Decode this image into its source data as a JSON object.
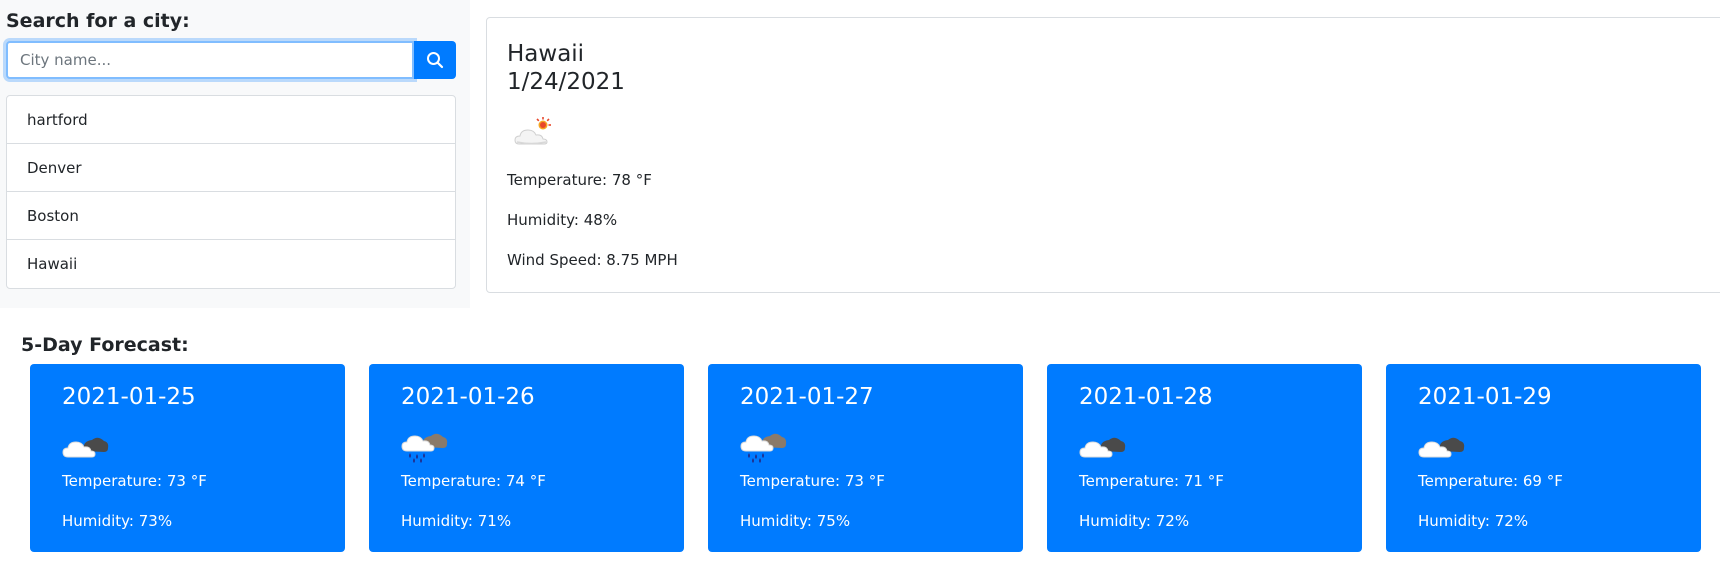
{
  "search": {
    "label": "Search for a city:",
    "placeholder": "City name..."
  },
  "history": [
    "hartford",
    "Denver",
    "Boston",
    "Hawaii"
  ],
  "current": {
    "city": "Hawaii",
    "date": "1/24/2021",
    "icon": "cloud-sun-icon",
    "temperature": "Temperature: 78 °F",
    "humidity": "Humidity: 48%",
    "wind": "Wind Speed: 8.75 MPH"
  },
  "forecast": {
    "title": "5-Day Forecast:",
    "days": [
      {
        "date": "2021-01-25",
        "icon": "cloud-icon",
        "temperature": "Temperature: 73 °F",
        "humidity": "Humidity: 73%"
      },
      {
        "date": "2021-01-26",
        "icon": "rain-icon",
        "temperature": "Temperature: 74 °F",
        "humidity": "Humidity: 71%"
      },
      {
        "date": "2021-01-27",
        "icon": "rain-icon",
        "temperature": "Temperature: 73 °F",
        "humidity": "Humidity: 75%"
      },
      {
        "date": "2021-01-28",
        "icon": "cloud-icon",
        "temperature": "Temperature: 71 °F",
        "humidity": "Humidity: 72%"
      },
      {
        "date": "2021-01-29",
        "icon": "cloud-icon",
        "temperature": "Temperature: 69 °F",
        "humidity": "Humidity: 72%"
      }
    ]
  },
  "colors": {
    "primary": "#007bff",
    "sidebar_bg": "#f8f9fa",
    "border": "#d9dde1"
  }
}
